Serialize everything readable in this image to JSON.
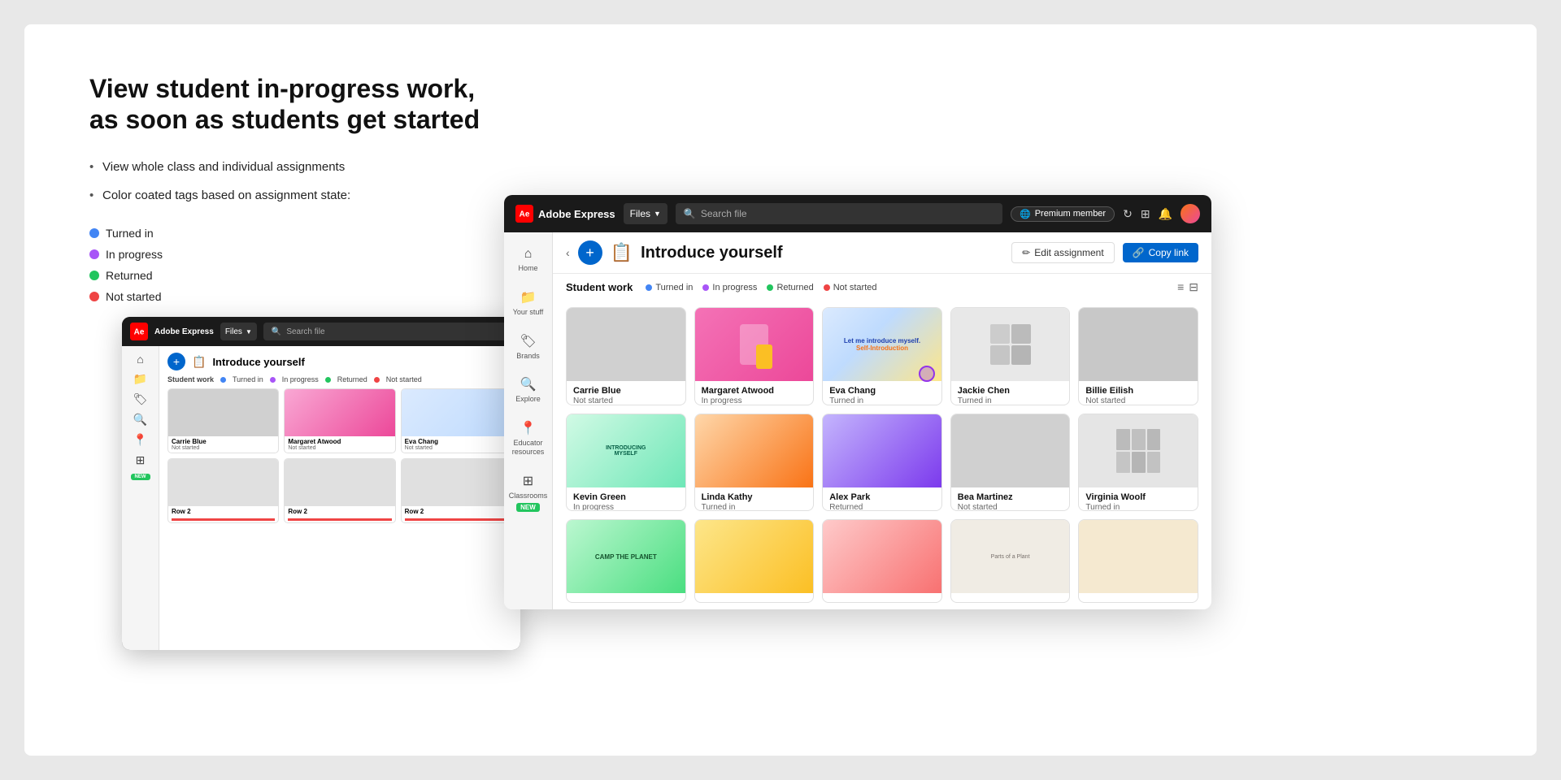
{
  "page": {
    "heading": "View student in-progress work,\nas soon as students get started",
    "bullets": [
      "View whole class and individual assignments",
      "Color coated tags based on assignment state:"
    ],
    "statusLabels": {
      "turned_in": "Turned in",
      "in_progress": "In progress",
      "returned": "Returned",
      "not_started": "Not started"
    }
  },
  "adobe_express_fg": {
    "header": {
      "logo_text": "Adobe Express",
      "dropdown": "Files",
      "search_placeholder": "Search file",
      "premium": "Premium member",
      "icons": [
        "refresh",
        "grid",
        "bell"
      ]
    },
    "assignment": {
      "emoji": "📋",
      "title": "Introduce yourself",
      "edit_label": "Edit assignment",
      "copy_link_label": "Copy link"
    },
    "student_work": {
      "title": "Student work",
      "statuses": [
        "Turned in",
        "In progress",
        "Returned",
        "Not started"
      ]
    },
    "students": [
      {
        "name": "Carrie Blue",
        "status": "Not started",
        "bar": "red",
        "thumb": "gray"
      },
      {
        "name": "Margaret Atwood",
        "status": "In progress",
        "bar": "purple",
        "thumb": "pink"
      },
      {
        "name": "Eva Chang",
        "status": "Turned in",
        "bar": "blue",
        "thumb": "self-intro"
      },
      {
        "name": "Jackie Chen",
        "status": "Turned in",
        "bar": "blue",
        "thumb": "sketch"
      },
      {
        "name": "Billie Eilish",
        "status": "Not started",
        "bar": "red",
        "thumb": "gray2"
      },
      {
        "name": "Kevin Green",
        "status": "In progress",
        "bar": "purple",
        "thumb": "green-text"
      },
      {
        "name": "Linda Kathy",
        "status": "Turned in",
        "bar": "blue",
        "thumb": "orange"
      },
      {
        "name": "Alex Park",
        "status": "Returned",
        "bar": "green",
        "thumb": "purple"
      },
      {
        "name": "Bea Martinez",
        "status": "Not started",
        "bar": "red",
        "thumb": "gray3"
      },
      {
        "name": "Virginia Woolf",
        "status": "Turned in",
        "bar": "blue",
        "thumb": "sketch2"
      }
    ]
  },
  "adobe_express_bg": {
    "header": {
      "logo_text": "Adobe Express",
      "dropdown": "Files",
      "search_placeholder": "Search file"
    },
    "assignment": {
      "emoji": "📋",
      "title": "Introduce yourself"
    },
    "students": [
      {
        "name": "Carrie Blue",
        "status": "Not started",
        "bar": "red"
      },
      {
        "name": "Margaret Atwood",
        "status": "Not started",
        "bar": "red"
      },
      {
        "name": "Eva Chang",
        "status": "Not started",
        "bar": "red"
      }
    ]
  },
  "sidebar": {
    "items": [
      {
        "label": "Home",
        "icon": "⌂"
      },
      {
        "label": "Your stuff",
        "icon": "📁"
      },
      {
        "label": "Brands",
        "icon": "🏷"
      },
      {
        "label": "Explore",
        "icon": "🔍"
      },
      {
        "label": "Educator resources",
        "icon": "📍"
      },
      {
        "label": "Classrooms",
        "icon": "⊞",
        "badge": "NEW"
      }
    ]
  }
}
